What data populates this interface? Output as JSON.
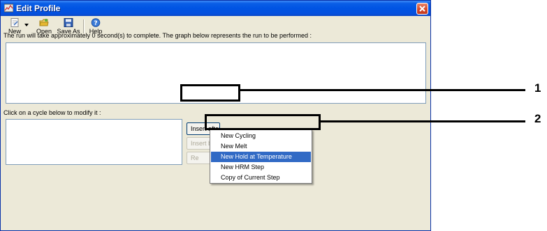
{
  "window": {
    "title": "Edit Profile"
  },
  "toolbar": {
    "new_label": "New",
    "open_label": "Open",
    "save_as_label": "Save As",
    "help_label": "Help"
  },
  "main": {
    "info_text": "The run will take approximately 0 second(s) to complete. The graph below represents the run to be performed :",
    "cycle_label": "Click on a cycle below to modify it :"
  },
  "buttons": {
    "insert_after": "Insert after",
    "insert_before": "Insert b",
    "remove": "Re"
  },
  "context_menu": {
    "items": [
      {
        "label": "New Cycling",
        "selected": false
      },
      {
        "label": "New Melt",
        "selected": false
      },
      {
        "label": "New Hold at Temperature",
        "selected": true
      },
      {
        "label": "New HRM Step",
        "selected": false
      },
      {
        "label": "Copy of Current Step",
        "selected": false
      }
    ]
  },
  "callouts": {
    "one": "1",
    "two": "2"
  },
  "colors": {
    "titlebar": "#0054e3",
    "selection": "#316ac5",
    "close_button": "#d6482a"
  },
  "icons": {
    "title": "profile-icon",
    "new": "new-document-icon",
    "open": "open-folder-icon",
    "save_as": "floppy-disk-icon",
    "help": "help-icon",
    "close": "close-icon"
  }
}
